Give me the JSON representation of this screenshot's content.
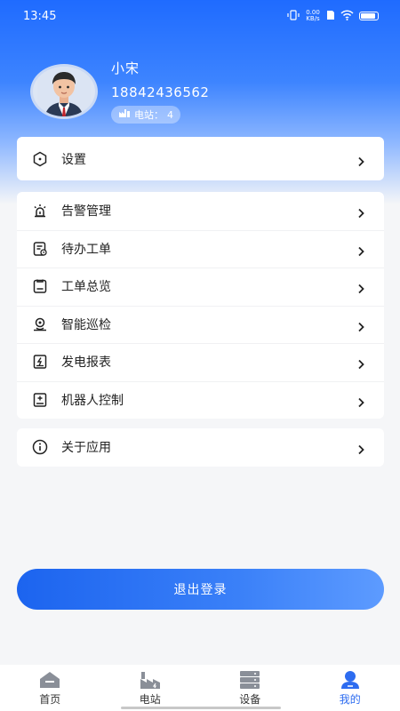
{
  "status_bar": {
    "time": "13:45",
    "network_speed": "0.00 KB/s"
  },
  "profile": {
    "name": "小宋",
    "phone": "18842436562",
    "station_label": "电站：",
    "station_count": "4"
  },
  "menu": {
    "settings": {
      "label": "设置",
      "icon": "hexagon-settings-icon"
    },
    "group": [
      {
        "label": "告警管理",
        "icon": "alarm-light-icon"
      },
      {
        "label": "待办工单",
        "icon": "todo-ticket-icon"
      },
      {
        "label": "工单总览",
        "icon": "clipboard-icon"
      },
      {
        "label": "智能巡检",
        "icon": "location-inspect-icon"
      },
      {
        "label": "发电报表",
        "icon": "power-report-icon"
      },
      {
        "label": "机器人控制",
        "icon": "robot-control-icon"
      }
    ],
    "about": {
      "label": "关于应用",
      "icon": "info-icon"
    }
  },
  "logout_label": "退出登录",
  "tabbar": {
    "items": [
      {
        "label": "首页",
        "icon": "home-icon"
      },
      {
        "label": "电站",
        "icon": "factory-icon"
      },
      {
        "label": "设备",
        "icon": "server-icon"
      },
      {
        "label": "我的",
        "icon": "user-icon"
      }
    ],
    "active_index": 3
  },
  "colors": {
    "primary": "#2d6cf0",
    "background": "#f5f6f8"
  }
}
